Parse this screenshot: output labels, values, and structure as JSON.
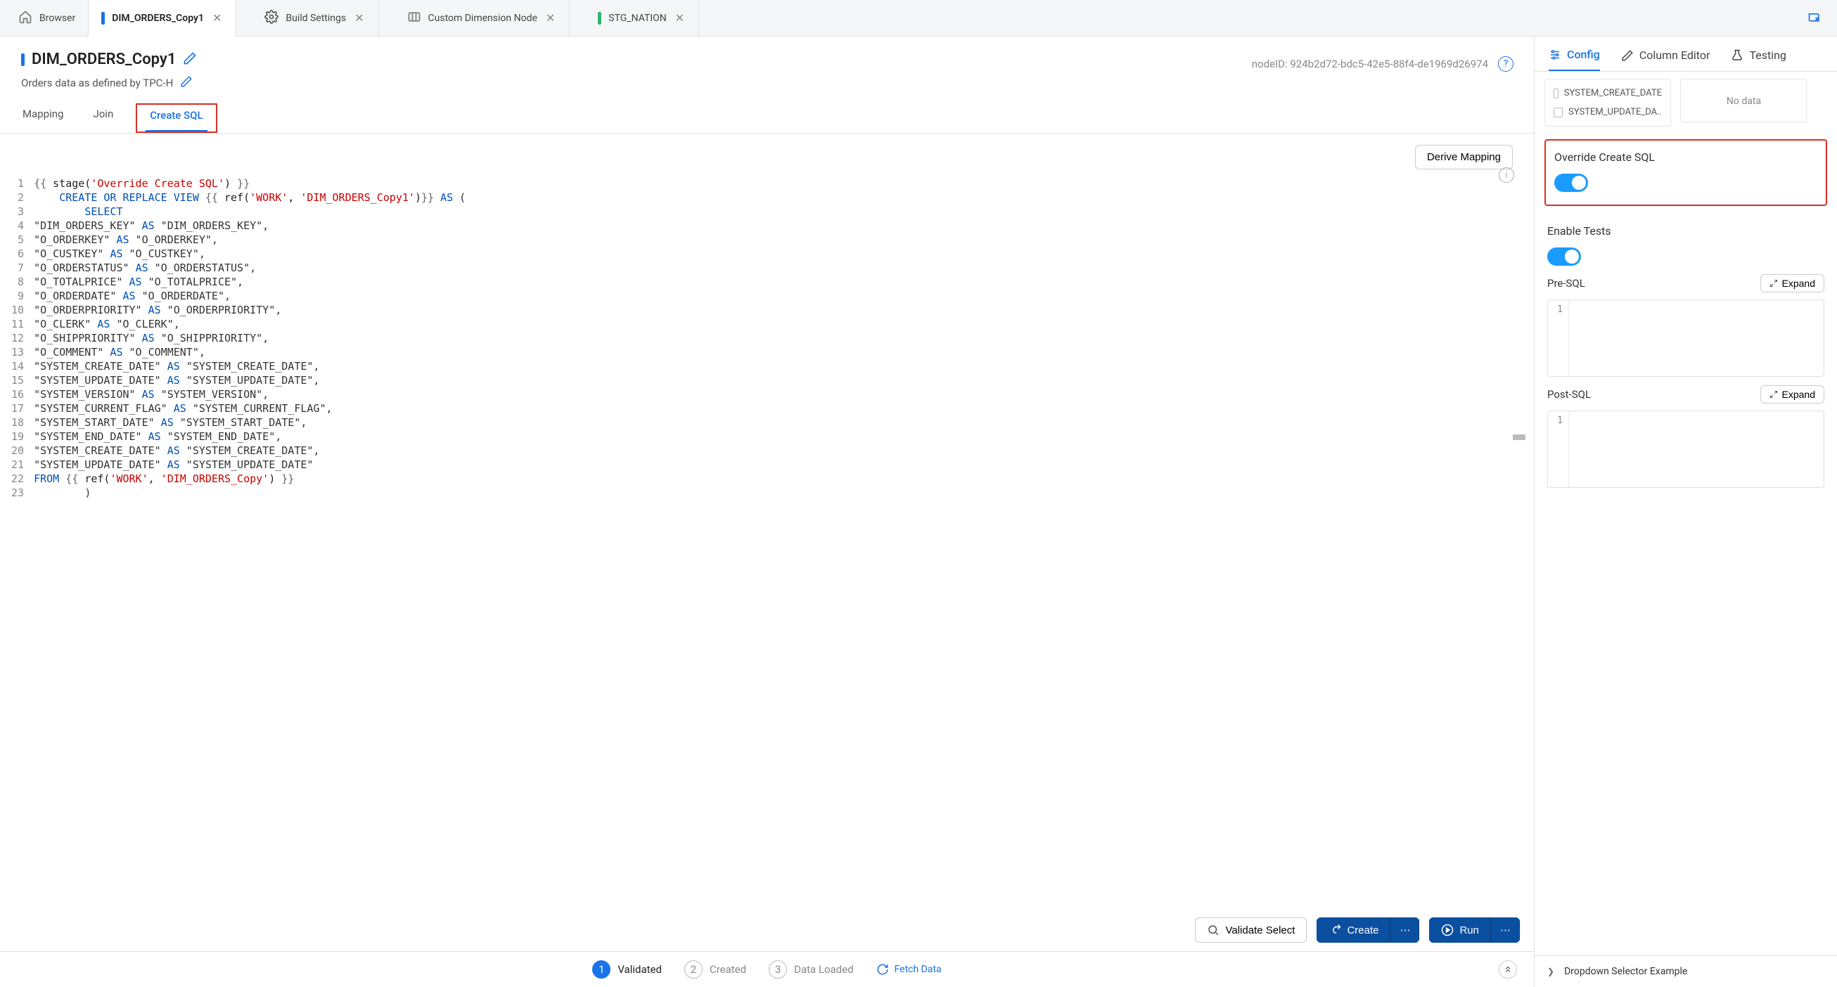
{
  "tabs": {
    "browser": "Browser",
    "items": [
      {
        "label": "DIM_ORDERS_Copy1",
        "icon": "bar-blue",
        "active": true
      },
      {
        "label": "Build Settings",
        "icon": "gear",
        "active": false
      },
      {
        "label": "Custom Dimension Node",
        "icon": "node",
        "active": false
      },
      {
        "label": "STG_NATION",
        "icon": "bar-green",
        "active": false
      }
    ]
  },
  "page": {
    "title": "DIM_ORDERS_Copy1",
    "subtitle": "Orders data as defined by TPC-H",
    "node_id_label": "nodeID: 924b2d72-bdc5-42e5-88f4-de1969d26974"
  },
  "subtabs": {
    "mapping": "Mapping",
    "join": "Join",
    "create_sql": "Create SQL"
  },
  "editor": {
    "derive_btn": "Derive Mapping",
    "code_lines": [
      [
        [
          "jinja",
          "{{ "
        ],
        [
          "stage",
          "stage("
        ],
        [
          "str",
          "'Override Create SQL'"
        ],
        [
          "stage",
          ") "
        ],
        [
          "jinja",
          "}}"
        ]
      ],
      [
        [
          "indent",
          "    "
        ],
        [
          "kw",
          "CREATE"
        ],
        [
          "sp",
          " "
        ],
        [
          "kw",
          "OR"
        ],
        [
          "sp",
          " "
        ],
        [
          "kw",
          "REPLACE"
        ],
        [
          "sp",
          " "
        ],
        [
          "kw",
          "VIEW"
        ],
        [
          "sp",
          " "
        ],
        [
          "jinja",
          "{{ "
        ],
        [
          "stage",
          "ref("
        ],
        [
          "str",
          "'WORK'"
        ],
        [
          "stage",
          ", "
        ],
        [
          "str",
          "'DIM_ORDERS_Copy1'"
        ],
        [
          "stage",
          ")"
        ],
        [
          "jinja",
          "}}"
        ],
        [
          "sp",
          " "
        ],
        [
          "kw",
          "AS"
        ],
        [
          "sp",
          " ("
        ]
      ],
      [
        [
          "indent",
          "        "
        ],
        [
          "kw",
          "SELECT"
        ]
      ],
      [
        [
          "plain",
          "\"DIM_ORDERS_KEY\" "
        ],
        [
          "kw",
          "AS"
        ],
        [
          "plain",
          " \"DIM_ORDERS_KEY\","
        ]
      ],
      [
        [
          "plain",
          "\"O_ORDERKEY\" "
        ],
        [
          "kw",
          "AS"
        ],
        [
          "plain",
          " \"O_ORDERKEY\","
        ]
      ],
      [
        [
          "plain",
          "\"O_CUSTKEY\" "
        ],
        [
          "kw",
          "AS"
        ],
        [
          "plain",
          " \"O_CUSTKEY\","
        ]
      ],
      [
        [
          "plain",
          "\"O_ORDERSTATUS\" "
        ],
        [
          "kw",
          "AS"
        ],
        [
          "plain",
          " \"O_ORDERSTATUS\","
        ]
      ],
      [
        [
          "plain",
          "\"O_TOTALPRICE\" "
        ],
        [
          "kw",
          "AS"
        ],
        [
          "plain",
          " \"O_TOTALPRICE\","
        ]
      ],
      [
        [
          "plain",
          "\"O_ORDERDATE\" "
        ],
        [
          "kw",
          "AS"
        ],
        [
          "plain",
          " \"O_ORDERDATE\","
        ]
      ],
      [
        [
          "plain",
          "\"O_ORDERPRIORITY\" "
        ],
        [
          "kw",
          "AS"
        ],
        [
          "plain",
          " \"O_ORDERPRIORITY\","
        ]
      ],
      [
        [
          "plain",
          "\"O_CLERK\" "
        ],
        [
          "kw",
          "AS"
        ],
        [
          "plain",
          " \"O_CLERK\","
        ]
      ],
      [
        [
          "plain",
          "\"O_SHIPPRIORITY\" "
        ],
        [
          "kw",
          "AS"
        ],
        [
          "plain",
          " \"O_SHIPPRIORITY\","
        ]
      ],
      [
        [
          "plain",
          "\"O_COMMENT\" "
        ],
        [
          "kw",
          "AS"
        ],
        [
          "plain",
          " \"O_COMMENT\","
        ]
      ],
      [
        [
          "plain",
          "\"SYSTEM_CREATE_DATE\" "
        ],
        [
          "kw",
          "AS"
        ],
        [
          "plain",
          " \"SYSTEM_CREATE_DATE\","
        ]
      ],
      [
        [
          "plain",
          "\"SYSTEM_UPDATE_DATE\" "
        ],
        [
          "kw",
          "AS"
        ],
        [
          "plain",
          " \"SYSTEM_UPDATE_DATE\","
        ]
      ],
      [
        [
          "plain",
          "\"SYSTEM_VERSION\" "
        ],
        [
          "kw",
          "AS"
        ],
        [
          "plain",
          " \"SYSTEM_VERSION\","
        ]
      ],
      [
        [
          "plain",
          "\"SYSTEM_CURRENT_FLAG\" "
        ],
        [
          "kw",
          "AS"
        ],
        [
          "plain",
          " \"SYSTEM_CURRENT_FLAG\","
        ]
      ],
      [
        [
          "plain",
          "\"SYSTEM_START_DATE\" "
        ],
        [
          "kw",
          "AS"
        ],
        [
          "plain",
          " \"SYSTEM_START_DATE\","
        ]
      ],
      [
        [
          "plain",
          "\"SYSTEM_END_DATE\" "
        ],
        [
          "kw",
          "AS"
        ],
        [
          "plain",
          " \"SYSTEM_END_DATE\","
        ]
      ],
      [
        [
          "plain",
          "\"SYSTEM_CREATE_DATE\" "
        ],
        [
          "kw",
          "AS"
        ],
        [
          "plain",
          " \"SYSTEM_CREATE_DATE\","
        ]
      ],
      [
        [
          "plain",
          "\"SYSTEM_UPDATE_DATE\" "
        ],
        [
          "kw",
          "AS"
        ],
        [
          "plain",
          " \"SYSTEM_UPDATE_DATE\""
        ]
      ],
      [
        [
          "kw",
          "FROM"
        ],
        [
          "sp",
          " "
        ],
        [
          "jinja",
          "{{ "
        ],
        [
          "stage",
          "ref("
        ],
        [
          "str",
          "'WORK'"
        ],
        [
          "stage",
          ", "
        ],
        [
          "str",
          "'DIM_ORDERS_Copy'"
        ],
        [
          "stage",
          ") "
        ],
        [
          "jinja",
          "}}"
        ]
      ],
      [
        [
          "indent",
          "        "
        ],
        [
          "plain",
          ")"
        ]
      ]
    ]
  },
  "actions": {
    "validate": "Validate Select",
    "create": "Create",
    "run": "Run"
  },
  "status": {
    "steps": [
      "Validated",
      "Created",
      "Data Loaded"
    ],
    "fetch": "Fetch Data"
  },
  "right_panel": {
    "tabs": {
      "config": "Config",
      "column_editor": "Column Editor",
      "testing": "Testing"
    },
    "columns": [
      "SYSTEM_CREATE_DATE",
      "SYSTEM_UPDATE_DA.."
    ],
    "no_data": "No data",
    "override_label": "Override Create SQL",
    "enable_tests_label": "Enable Tests",
    "pre_sql": "Pre-SQL",
    "post_sql": "Post-SQL",
    "expand": "Expand",
    "accordion": "Dropdown Selector Example"
  }
}
